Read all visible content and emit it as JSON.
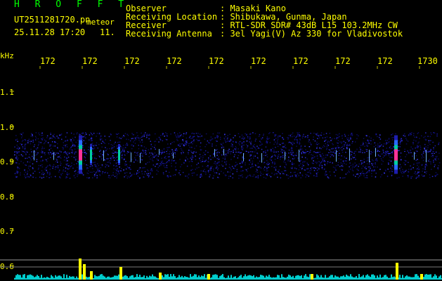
{
  "header": {
    "program": "H R O F F T",
    "filename": "UT2511281720.pn",
    "meteor_word": "meteor",
    "datetime": "25.11.28 17:20",
    "count": "11.",
    "fields": [
      {
        "label": "Observer",
        "value": ": Masaki Kano"
      },
      {
        "label": "Receiving Location",
        "value": ": Shibukawa, Gunma, Japan"
      },
      {
        "label": "Receiver",
        "value": ": RTL-SDR SDR# 43dB L15 103.2MHz CW"
      },
      {
        "label": "Receiving Antenna",
        "value": ": 3el Yagi(V) Az 330 for Vladivostok"
      }
    ]
  },
  "time_axis": {
    "labels": [
      "172",
      "172",
      "172",
      "172",
      "172",
      "172",
      "172",
      "172",
      "172",
      "1730"
    ]
  },
  "freq_axis": {
    "unit": "kHz",
    "labels": [
      "1.1",
      "1.0",
      "0.9",
      "0.8",
      "0.7",
      "0.6"
    ]
  },
  "colors": {
    "text": "#ffff00",
    "title": "#00ff00",
    "signal_hot": "#ff3399",
    "signal_mid": "#00ff66",
    "noise": "#1a1aa0",
    "baseline": "#00cccc",
    "meteor_bar": "#ffff00"
  },
  "meteor_events": [
    {
      "time_index": 1,
      "strength": "strong"
    },
    {
      "time_index": 1.3,
      "strength": "weak"
    },
    {
      "time_index": 2.6,
      "strength": "medium"
    },
    {
      "time_index": 9.1,
      "strength": "strong"
    }
  ]
}
